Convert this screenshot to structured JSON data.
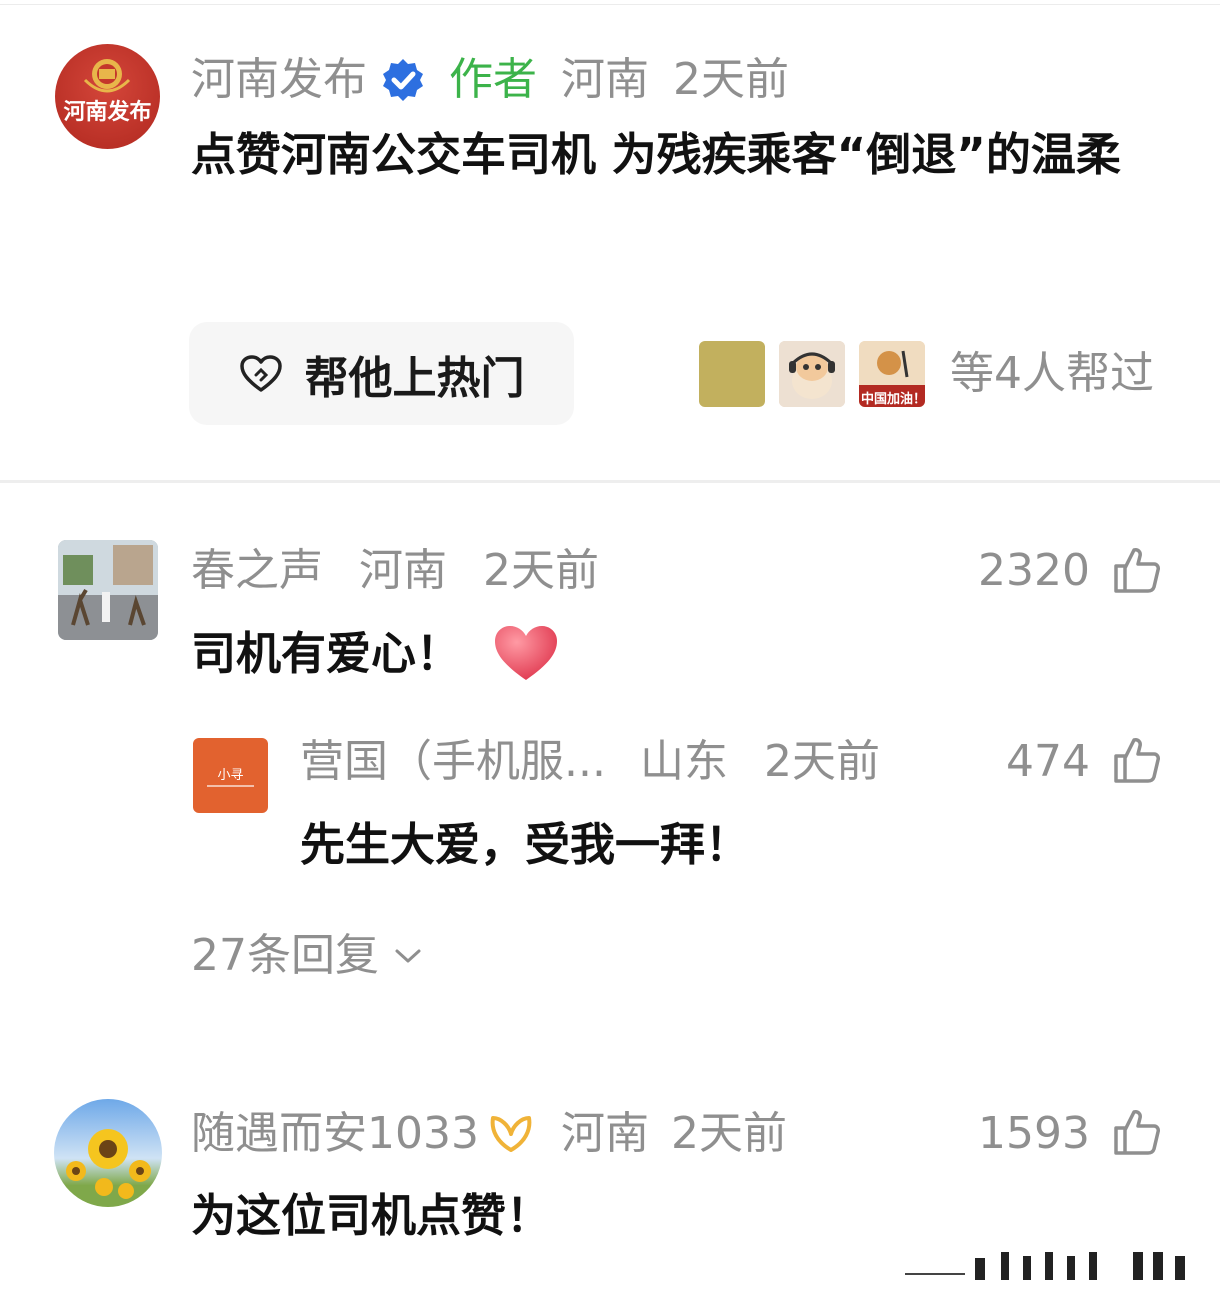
{
  "post": {
    "author": "河南发布",
    "avatar_text": "河南发布",
    "author_tag": "作者",
    "location": "河南",
    "time": "2天前",
    "text": "点赞河南公交车司机 为残疾乘客“倒退”的温柔"
  },
  "boost": {
    "button_label": "帮他上热门",
    "helpers_label": "等4人帮过",
    "helper3_text": "中国加油！"
  },
  "comments": [
    {
      "username": "春之声",
      "location": "河南",
      "time": "2天前",
      "likes": "2320",
      "text": "司机有爱心！",
      "reply": {
        "username": "营国（手机服...",
        "avatar_text": "小寻",
        "location": "山东",
        "time": "2天前",
        "likes": "474",
        "text": "先生大爱，受我一拜！"
      },
      "replies_count": "27条回复"
    },
    {
      "username": "随遇而安1033",
      "location": "河南",
      "time": "2天前",
      "likes": "1593",
      "text": "为这位司机点赞！"
    }
  ],
  "colors": {
    "author_tag": "#3cb34a",
    "verified_badge": "#2d6fe0",
    "avatar_red": "#c4372b",
    "reply_avatar_orange": "#e2622f",
    "heart": "#ef5b6c",
    "meta_gray": "#8f8f8f"
  },
  "icons": [
    "verified-badge-icon",
    "heart-boost-icon",
    "thumbs-up-icon",
    "chevron-down-icon",
    "heart-emoji-icon",
    "member-badge-icon"
  ]
}
